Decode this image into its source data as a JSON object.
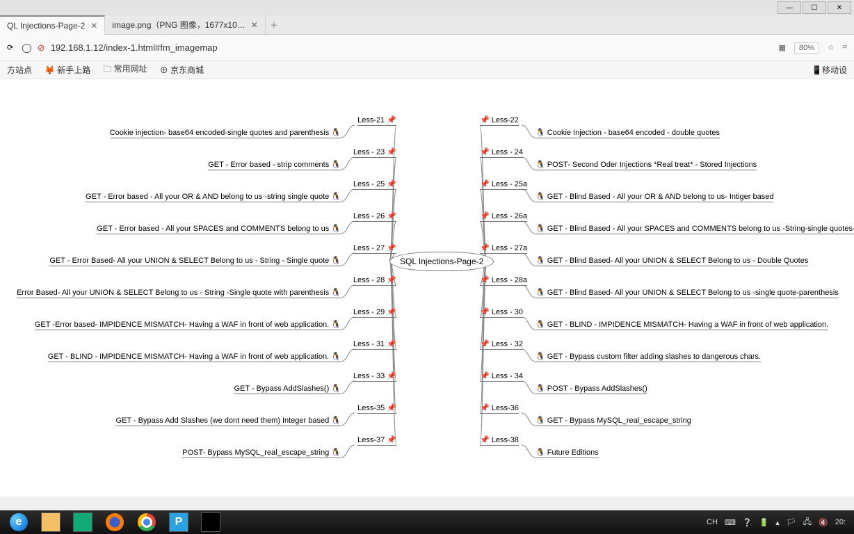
{
  "window": {
    "min": "—",
    "max": "☐",
    "close": "✕"
  },
  "tabs": [
    {
      "title": "QL Injections-Page-2",
      "active": true
    },
    {
      "title": "image.png（PNG 图像，1677x10…",
      "active": false
    }
  ],
  "addr": {
    "reload": "⟳",
    "shield": "◯",
    "lock": "⊘",
    "url": "192.168.1.12/index-1.html#fm_imagemap",
    "qr": "▦",
    "zoom": "80%",
    "star": "☆",
    "crop": "⌗"
  },
  "bookmarks": {
    "b1": "方站点",
    "b2": "新手上路",
    "b3": "常用网址",
    "b4": "京东商城",
    "mobile": "移动设"
  },
  "mindmap": {
    "center": "SQL Injections-Page-2",
    "left": [
      {
        "title": "Less-21",
        "sub": "Cookie injection- base64 encoded-single quotes and parenthesis"
      },
      {
        "title": "Less - 23",
        "sub": "GET - Error based - strip comments"
      },
      {
        "title": "Less - 25",
        "sub": "GET - Error based - All your OR & AND belong to us -string single quote"
      },
      {
        "title": "Less - 26",
        "sub": "GET - Error based - All your SPACES and COMMENTS belong to us"
      },
      {
        "title": "Less - 27",
        "sub": "GET - Error Based- All your UNION & SELECT Belong to us - String - Single quote"
      },
      {
        "title": "Less - 28",
        "sub": "Error Based- All your UNION & SELECT Belong to us - String -Single quote with parenthesis"
      },
      {
        "title": "Less - 29",
        "sub": "GET -Error based- IMPIDENCE MISMATCH- Having a WAF in front of web application."
      },
      {
        "title": "Less - 31",
        "sub": "GET - BLIND - IMPIDENCE MISMATCH- Having a WAF in front of web application."
      },
      {
        "title": "Less - 33",
        "sub": "GET - Bypass AddSlashes()"
      },
      {
        "title": "Less-35",
        "sub": "GET - Bypass Add Slashes (we dont need them) Integer based"
      },
      {
        "title": "Less-37",
        "sub": "POST- Bypass MySQL_real_escape_string"
      }
    ],
    "right": [
      {
        "title": "Less-22",
        "sub": "Cookie Injection - base64 encoded - double quotes"
      },
      {
        "title": "Less - 24",
        "sub": "POST- Second Oder Injections *Real treat* - Stored Injections"
      },
      {
        "title": "Less - 25a",
        "sub": "GET - Blind Based - All your OR & AND belong to us- Intiger based"
      },
      {
        "title": "Less - 26a",
        "sub": "GET - Blind Based - All your SPACES and COMMENTS belong to us -String-single quotes-Parenthesis"
      },
      {
        "title": "Less - 27a",
        "sub": "GET - Blind Based- All your UNION & SELECT Belong to us - Double Quotes"
      },
      {
        "title": "Less - 28a",
        "sub": "GET - Blind Based- All your UNION & SELECT Belong to us -single quote-parenthesis"
      },
      {
        "title": "Less - 30",
        "sub": "GET - BLIND - IMPIDENCE MISMATCH- Having a WAF in front of web application."
      },
      {
        "title": "Less - 32",
        "sub": "GET - Bypass custom filter adding slashes to dangerous chars."
      },
      {
        "title": "Less - 34",
        "sub": "POST - Bypass AddSlashes()"
      },
      {
        "title": "Less-36",
        "sub": "GET - Bypass MySQL_real_escape_string"
      },
      {
        "title": "Less-38",
        "sub": "Future Editions"
      }
    ]
  },
  "taskbar": {
    "lang": "CH",
    "time": "20:"
  }
}
